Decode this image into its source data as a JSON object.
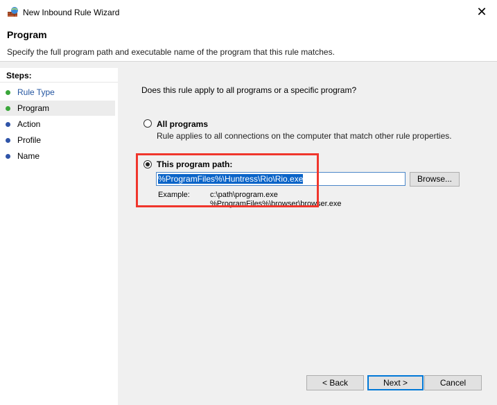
{
  "window": {
    "title": "New Inbound Rule Wizard",
    "close_glyph": "✕"
  },
  "header": {
    "title": "Program",
    "description": "Specify the full program path and executable name of the program that this rule matches."
  },
  "steps": {
    "heading": "Steps:",
    "items": [
      {
        "label": "Rule Type",
        "state": "done"
      },
      {
        "label": "Program",
        "state": "current"
      },
      {
        "label": "Action",
        "state": "pending"
      },
      {
        "label": "Profile",
        "state": "pending"
      },
      {
        "label": "Name",
        "state": "pending"
      }
    ]
  },
  "content": {
    "question": "Does this rule apply to all programs or a specific program?",
    "option_all": {
      "label": "All programs",
      "description": "Rule applies to all connections on the computer that match other rule properties.",
      "checked": false
    },
    "option_path": {
      "label": "This program path:",
      "checked": true,
      "value": "%ProgramFiles%\\Huntress\\Rio\\Rio.exe",
      "browse_label": "Browse..."
    },
    "example": {
      "label": "Example:",
      "line1": "c:\\path\\program.exe",
      "line2": "%ProgramFiles%\\browser\\browser.exe"
    }
  },
  "footer": {
    "back_label": "< Back",
    "next_label": "Next >",
    "cancel_label": "Cancel"
  },
  "colors": {
    "highlight_box": "#f0362c",
    "step_done": "#3aa63a",
    "step_pending": "#2f54a8",
    "selection": "#0a64c8"
  }
}
